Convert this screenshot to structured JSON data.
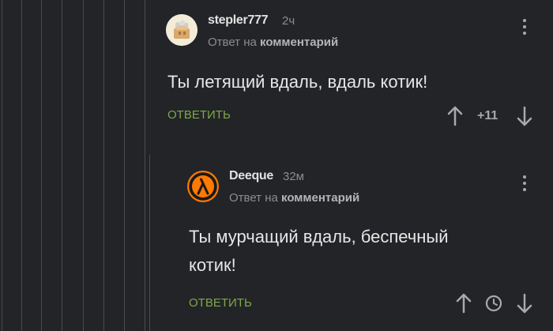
{
  "comments": [
    {
      "username": "stepler777",
      "time": "2ч",
      "reply_prefix": "Ответ на",
      "reply_target": "комментарий",
      "text": "Ты летящий вдаль, вдаль котик!",
      "reply_label": "ОТВЕТИТЬ",
      "rating": "+11"
    },
    {
      "username": "Deeque",
      "time": "32м",
      "reply_prefix": "Ответ на",
      "reply_target": "комментарий",
      "text_line1": "Ты мурчащий вдаль, беспечный",
      "text_line2": "котик!",
      "reply_label": "ОТВЕТИТЬ"
    }
  ],
  "icons": {
    "upvote": "arrow-up-icon",
    "downvote": "arrow-down-icon",
    "menu": "kebab-menu-icon",
    "timer": "clock-icon"
  },
  "colors": {
    "background": "#232427",
    "accent_reply": "#7ea84a",
    "thread_line": "#4a4b4f"
  }
}
